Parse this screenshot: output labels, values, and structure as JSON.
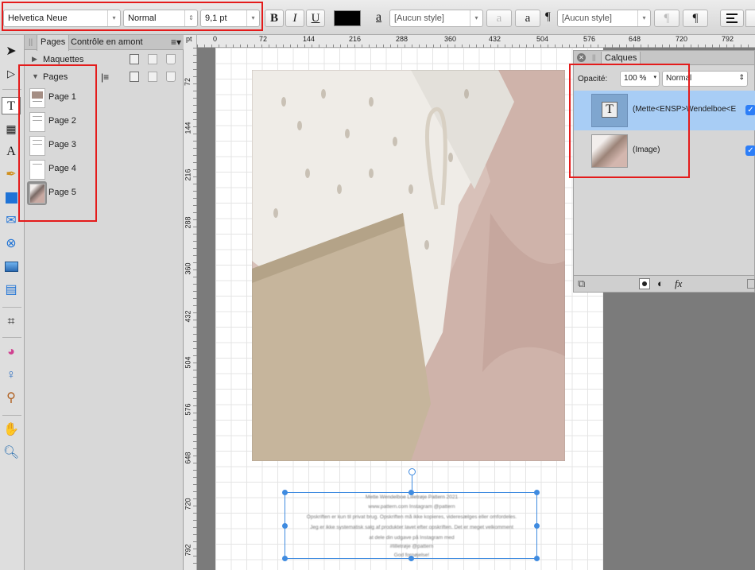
{
  "toolbar": {
    "font_family": "Helvetica Neue",
    "font_style": "Normal",
    "font_size": "9,1 pt",
    "bold_label": "B",
    "italic_label": "I",
    "underline_label": "U",
    "text_color": "#000000",
    "char_style_glyph": "a",
    "char_style": "[Aucun style]",
    "char_style_btn_1": "a",
    "char_style_btn_2": "a",
    "para_style_glyph": "¶",
    "para_style": "[Aucun style]",
    "para_btn_1": "¶",
    "para_btn_2": "¶"
  },
  "pages_panel": {
    "tabs": [
      "Pages",
      "Contrôle en amont"
    ],
    "masters_label": "Maquettes",
    "pages_label": "Pages",
    "pages": [
      "Page 1",
      "Page 2",
      "Page 3",
      "Page 4",
      "Page 5"
    ]
  },
  "ruler_unit": "pt",
  "ruler_top": [
    "0",
    "72",
    "144",
    "216",
    "288",
    "360",
    "432",
    "504",
    "576",
    "648",
    "720",
    "792"
  ],
  "ruler_left": [
    "72",
    "144",
    "216",
    "288",
    "360",
    "432",
    "504",
    "576",
    "648",
    "720",
    "792"
  ],
  "layers_panel": {
    "title": "Calques",
    "opacity_label": "Opacité:",
    "opacity_value": "100 %",
    "blend_mode": "Normal",
    "layers": [
      {
        "name": "(Mette<ENSP>Wendelboe<E",
        "thumb": "T",
        "checked": "✓"
      },
      {
        "name": "(Image)",
        "checked": "✓"
      }
    ],
    "fx_label": "fx"
  },
  "highlight_color": "#e41b1b",
  "selection_color": "#3f8be0"
}
